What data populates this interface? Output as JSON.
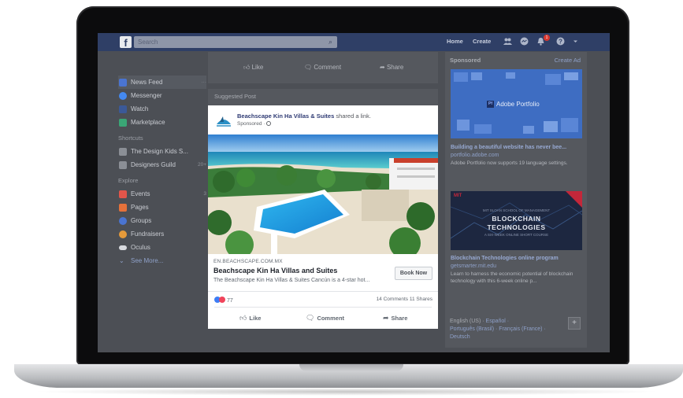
{
  "topbar": {
    "logo": "f",
    "search_placeholder": "Search",
    "links": [
      "Home",
      "Create"
    ],
    "notification_count": "1",
    "icons": [
      "friends-icon",
      "messenger-icon",
      "notifications-icon",
      "help-icon",
      "dropdown-icon"
    ]
  },
  "sidebar": {
    "items": [
      {
        "label": "News Feed",
        "more": "···",
        "color": "#4a74d1"
      },
      {
        "label": "Messenger",
        "count": "",
        "color": "#4489f0"
      },
      {
        "label": "Watch",
        "count": "",
        "color": "#3b5998"
      },
      {
        "label": "Marketplace",
        "count": "",
        "color": "#3aa676"
      }
    ],
    "shortcuts_label": "Shortcuts",
    "shortcuts": [
      {
        "label": "The Design Kids S...",
        "count": ""
      },
      {
        "label": "Designers Guild",
        "count": "20+"
      }
    ],
    "explore_label": "Explore",
    "explore": [
      {
        "label": "Events",
        "count": "3",
        "color": "#e2554a"
      },
      {
        "label": "Pages",
        "count": "",
        "color": "#e5713a"
      },
      {
        "label": "Groups",
        "count": "",
        "color": "#4a74d1"
      },
      {
        "label": "Fundraisers",
        "count": "",
        "color": "#e59a3a"
      },
      {
        "label": "Oculus",
        "count": "",
        "color": "#d8dadf"
      }
    ],
    "see_more": "See More..."
  },
  "prev_post_actions": {
    "like": "Like",
    "comment": "Comment",
    "share": "Share"
  },
  "suggested_label": "Suggested Post",
  "post": {
    "author": "Beachscape Kin Ha Villas & Suites",
    "author_suffix": "shared a link.",
    "sponsored": "Sponsored ·",
    "domain": "EN.BEACHSCAPE.COM.MX",
    "title": "Beachscape Kin Ha Villas and Suites",
    "description": "The Beachscape Kin Ha Villas & Suites Cancún is a 4-star hot...",
    "cta": "Book Now",
    "reaction_count": "77",
    "comments": "14 Comments",
    "shares": "11 Shares",
    "actions": {
      "like": "Like",
      "comment": "Comment",
      "share": "Share"
    }
  },
  "right": {
    "sponsored": "Sponsored",
    "create_ad": "Create Ad",
    "ad1": {
      "image_label": "Adobe Portfolio",
      "badge": "Pf",
      "title": "Building a beautiful website has never bee...",
      "domain": "portfolio.adobe.com",
      "desc": "Adobe Portfolio now supports 19 language settings."
    },
    "ad2": {
      "logo": "MIT",
      "sub_top": "MIT SLOAN SCHOOL OF MANAGEMENT",
      "image_title1": "BLOCKCHAIN",
      "image_title2": "TECHNOLOGIES",
      "sub_bottom": "A SIX-WEEK ONLINE SHORT COURSE",
      "title": "Blockchain Technologies online program",
      "domain": "getsmarter.mit.edu",
      "desc": "Learn to harness the economic potential of blockchain technology with this 6-week online p..."
    },
    "languages": {
      "line1_current": "English (US) ·",
      "line1_rest": "Español ·",
      "line2": "Português (Brasil) · Français (France) ·",
      "line3": "Deutsch",
      "plus": "+"
    }
  }
}
